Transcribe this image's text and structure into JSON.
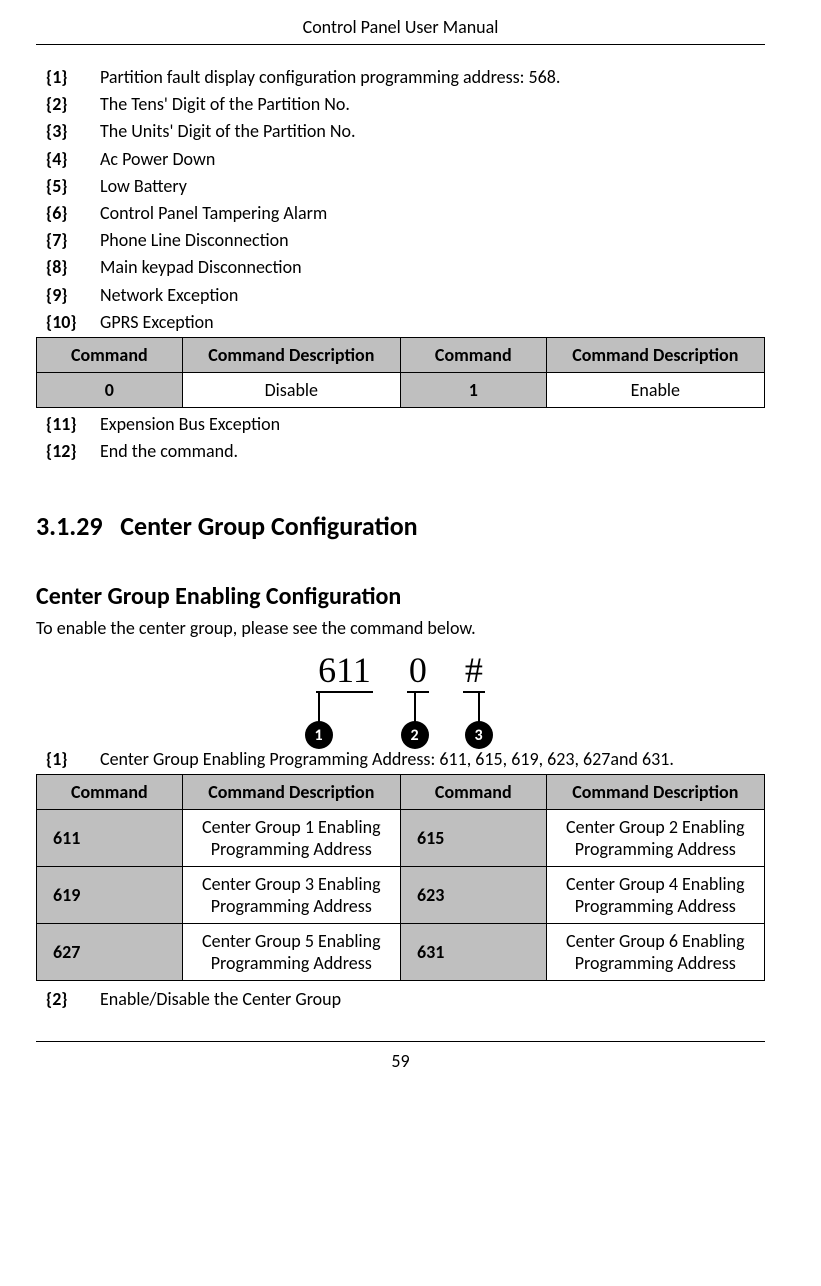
{
  "header": {
    "title": "Control Panel User Manual"
  },
  "list1": {
    "items": [
      {
        "n": "{1}",
        "t": "Partition fault display configuration programming address: 568."
      },
      {
        "n": "{2}",
        "t": "The Tens' Digit of the Partition No."
      },
      {
        "n": "{3}",
        "t": "The Units' Digit of the Partition No."
      },
      {
        "n": "{4}",
        "t": "Ac Power Down"
      },
      {
        "n": "{5}",
        "t": "Low Battery"
      },
      {
        "n": "{6}",
        "t": "Control Panel Tampering Alarm"
      },
      {
        "n": "{7}",
        "t": "Phone Line Disconnection"
      },
      {
        "n": "{8}",
        "t": "Main keypad Disconnection"
      },
      {
        "n": "{9}",
        "t": "Network Exception"
      },
      {
        "n": "{10}",
        "t": "GPRS Exception"
      }
    ]
  },
  "table1": {
    "headers": [
      "Command",
      "Command Description",
      "Command",
      "Command Description"
    ],
    "rows": [
      {
        "c1": "0",
        "c2": "Disable",
        "c3": "1",
        "c4": "Enable"
      }
    ]
  },
  "list1b": {
    "items": [
      {
        "n": "{11}",
        "t": "Expension Bus Exception"
      },
      {
        "n": "{12}",
        "t": "End the command."
      }
    ]
  },
  "section": {
    "num": "3.1.29",
    "title": "Center Group Configuration",
    "sub": "Center Group Enabling Configuration",
    "intro": "To enable the center group, please see the command below."
  },
  "diagram": {
    "seg1": "611",
    "seg2": "0",
    "seg3": "#",
    "b1": "1",
    "b2": "2",
    "b3": "3"
  },
  "legend1": {
    "n": "{1}",
    "t": "Center Group Enabling Programming Address: 611, 615, 619, 623, 627and 631."
  },
  "table2": {
    "headers": [
      "Command",
      "Command Description",
      "Command",
      "Command Description"
    ],
    "rows": [
      {
        "c1": "611",
        "c2": "Center Group 1 Enabling Programming Address",
        "c3": "615",
        "c4": "Center Group 2 Enabling Programming Address"
      },
      {
        "c1": "619",
        "c2": "Center Group 3 Enabling Programming Address",
        "c3": "623",
        "c4": "Center Group 4 Enabling Programming Address"
      },
      {
        "c1": "627",
        "c2": "Center Group 5 Enabling Programming Address",
        "c3": "631",
        "c4": "Center Group 6 Enabling Programming Address"
      }
    ]
  },
  "legend2": {
    "n": "{2}",
    "t": "Enable/Disable the Center Group"
  },
  "footer": {
    "page": "59"
  }
}
